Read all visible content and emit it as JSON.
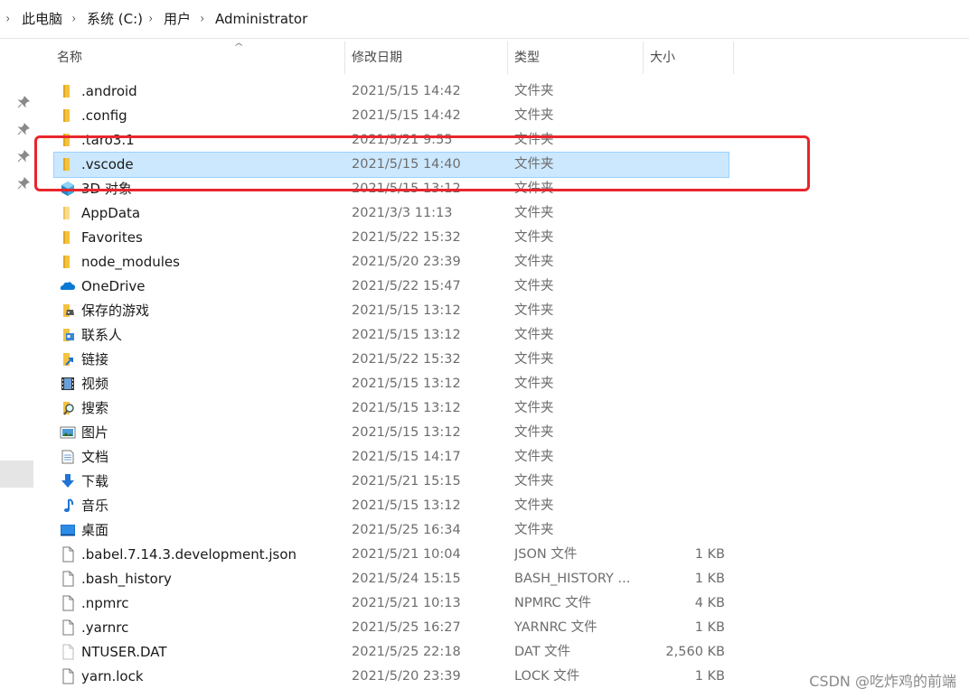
{
  "breadcrumb": {
    "items": [
      "此电脑",
      "系统 (C:)",
      "用户",
      "Administrator"
    ]
  },
  "columns": {
    "name": "名称",
    "modified": "修改日期",
    "type": "类型",
    "size": "大小"
  },
  "files": [
    {
      "name": ".android",
      "date": "2021/5/15 14:42",
      "type": "文件夹",
      "size": "",
      "icon": "folder-icon"
    },
    {
      "name": ".config",
      "date": "2021/5/15 14:42",
      "type": "文件夹",
      "size": "",
      "icon": "folder-icon"
    },
    {
      "name": ".taro3.1",
      "date": "2021/5/21 9:55",
      "type": "文件夹",
      "size": "",
      "icon": "folder-icon"
    },
    {
      "name": ".vscode",
      "date": "2021/5/15 14:40",
      "type": "文件夹",
      "size": "",
      "icon": "folder-icon",
      "selected": true
    },
    {
      "name": "3D 对象",
      "date": "2021/5/15 13:12",
      "type": "文件夹",
      "size": "",
      "icon": "3d-objects-icon"
    },
    {
      "name": "AppData",
      "date": "2021/3/3 11:13",
      "type": "文件夹",
      "size": "",
      "icon": "folder-hidden-icon"
    },
    {
      "name": "Favorites",
      "date": "2021/5/22 15:32",
      "type": "文件夹",
      "size": "",
      "icon": "folder-icon"
    },
    {
      "name": "node_modules",
      "date": "2021/5/20 23:39",
      "type": "文件夹",
      "size": "",
      "icon": "folder-icon"
    },
    {
      "name": "OneDrive",
      "date": "2021/5/22 15:47",
      "type": "文件夹",
      "size": "",
      "icon": "onedrive-icon"
    },
    {
      "name": "保存的游戏",
      "date": "2021/5/15 13:12",
      "type": "文件夹",
      "size": "",
      "icon": "saved-games-icon"
    },
    {
      "name": "联系人",
      "date": "2021/5/15 13:12",
      "type": "文件夹",
      "size": "",
      "icon": "contacts-icon"
    },
    {
      "name": "链接",
      "date": "2021/5/22 15:32",
      "type": "文件夹",
      "size": "",
      "icon": "links-icon"
    },
    {
      "name": "视频",
      "date": "2021/5/15 13:12",
      "type": "文件夹",
      "size": "",
      "icon": "videos-icon"
    },
    {
      "name": "搜索",
      "date": "2021/5/15 13:12",
      "type": "文件夹",
      "size": "",
      "icon": "searches-icon"
    },
    {
      "name": "图片",
      "date": "2021/5/15 13:12",
      "type": "文件夹",
      "size": "",
      "icon": "pictures-icon"
    },
    {
      "name": "文档",
      "date": "2021/5/15 14:17",
      "type": "文件夹",
      "size": "",
      "icon": "documents-icon"
    },
    {
      "name": "下载",
      "date": "2021/5/21 15:15",
      "type": "文件夹",
      "size": "",
      "icon": "downloads-icon"
    },
    {
      "name": "音乐",
      "date": "2021/5/15 13:12",
      "type": "文件夹",
      "size": "",
      "icon": "music-icon"
    },
    {
      "name": "桌面",
      "date": "2021/5/25 16:34",
      "type": "文件夹",
      "size": "",
      "icon": "desktop-icon"
    },
    {
      "name": ".babel.7.14.3.development.json",
      "date": "2021/5/21 10:04",
      "type": "JSON 文件",
      "size": "1 KB",
      "icon": "file-icon"
    },
    {
      "name": ".bash_history",
      "date": "2021/5/24 15:15",
      "type": "BASH_HISTORY ...",
      "size": "1 KB",
      "icon": "file-icon"
    },
    {
      "name": ".npmrc",
      "date": "2021/5/21 10:13",
      "type": "NPMRC 文件",
      "size": "4 KB",
      "icon": "file-icon"
    },
    {
      "name": ".yarnrc",
      "date": "2021/5/25 16:27",
      "type": "YARNRC 文件",
      "size": "1 KB",
      "icon": "file-icon"
    },
    {
      "name": "NTUSER.DAT",
      "date": "2021/5/25 22:18",
      "type": "DAT 文件",
      "size": "2,560 KB",
      "icon": "file-hidden-icon"
    },
    {
      "name": "yarn.lock",
      "date": "2021/5/20 23:39",
      "type": "LOCK 文件",
      "size": "1 KB",
      "icon": "file-icon"
    }
  ],
  "watermark": "CSDN @吃炸鸡的前端",
  "colors": {
    "selection_bg": "#cce8ff",
    "selection_border": "#99d1ff",
    "annotation_red": "#e8262c",
    "folder_yellow": "#f7c948"
  }
}
